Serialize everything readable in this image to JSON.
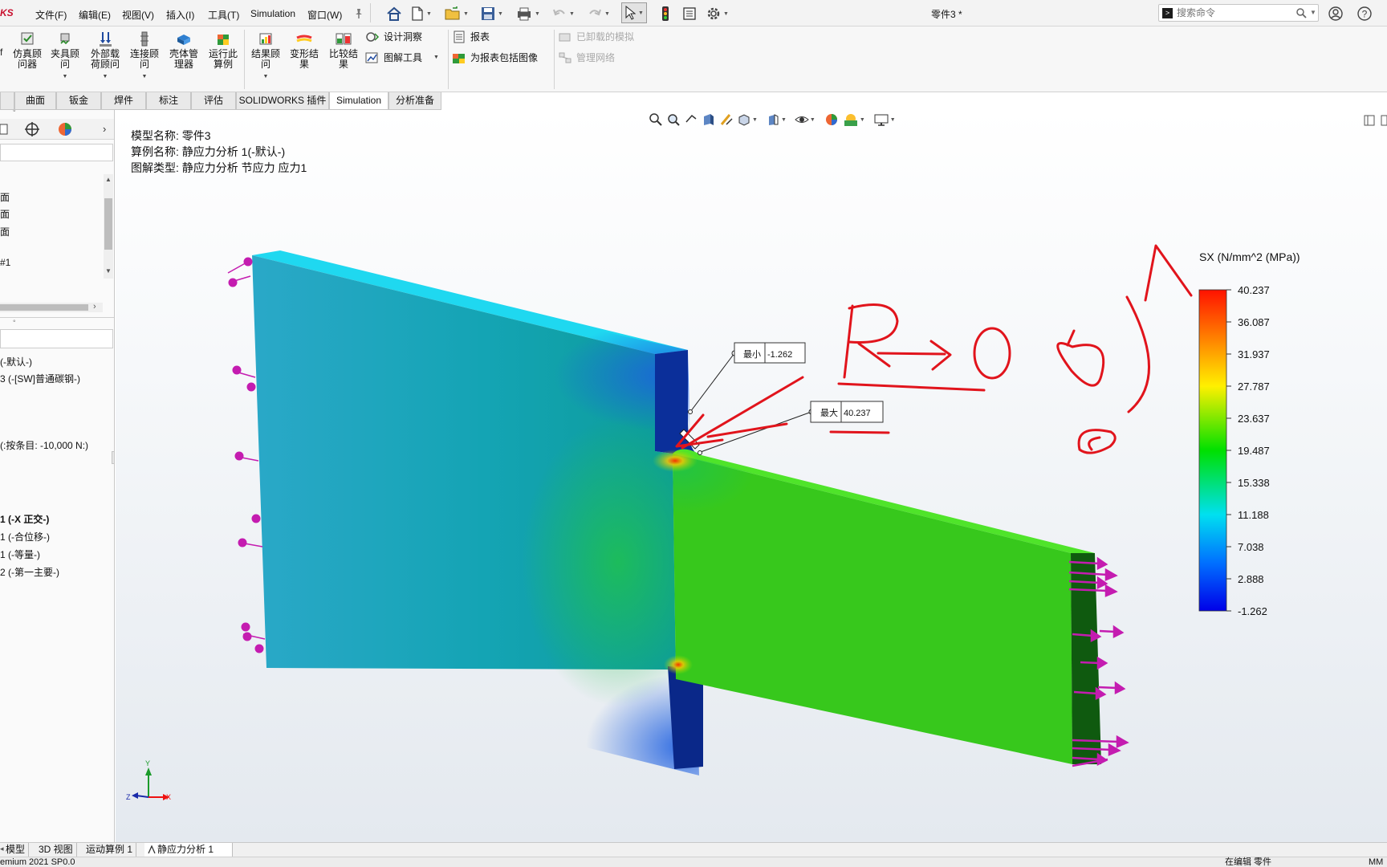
{
  "app": {
    "logo_text": "KS",
    "document_title": "零件3 *"
  },
  "menu": [
    {
      "label": "文件(F)"
    },
    {
      "label": "编辑(E)"
    },
    {
      "label": "视图(V)"
    },
    {
      "label": "插入(I)"
    },
    {
      "label": "工具(T)"
    },
    {
      "label": "Simulation"
    },
    {
      "label": "窗口(W)"
    }
  ],
  "search": {
    "placeholder": "搜索命令"
  },
  "ribbon": {
    "left_partial_label": "f",
    "buttons": [
      {
        "name": "simulation-advisor",
        "line1": "仿真顾",
        "line2": "问器",
        "icon": "advisor-icon"
      },
      {
        "name": "fixtures-advisor",
        "line1": "夹具顾",
        "line2": "问",
        "icon": "fixture-icon"
      },
      {
        "name": "external-loads-advisor",
        "line1": "外部载",
        "line2": "荷顾问",
        "icon": "load-icon"
      },
      {
        "name": "connections-advisor",
        "line1": "连接顾",
        "line2": "问",
        "icon": "connection-icon"
      },
      {
        "name": "shell-manager",
        "line1": "壳体管",
        "line2": "理器",
        "icon": "shell-icon"
      },
      {
        "name": "run-study",
        "line1": "运行此",
        "line2": "算例",
        "icon": "run-icon"
      },
      {
        "name": "results-advisor",
        "line1": "结果顾",
        "line2": "问",
        "icon": "results-icon"
      },
      {
        "name": "deformed-result",
        "line1": "变形结",
        "line2": "果",
        "icon": "deformed-icon"
      },
      {
        "name": "compare-results",
        "line1": "比较结",
        "line2": "果",
        "icon": "compare-icon"
      }
    ],
    "design_insight": "设计洞察",
    "plot_tools": "图解工具",
    "report": "报表",
    "include_image": "为报表包括图像",
    "unloaded_sims": "已卸载的模拟",
    "manage_network": "管理网络"
  },
  "command_tabs": [
    {
      "label": "曲面",
      "active": false
    },
    {
      "label": "钣金",
      "active": false
    },
    {
      "label": "焊件",
      "active": false
    },
    {
      "label": "标注",
      "active": false
    },
    {
      "label": "评估",
      "active": false
    },
    {
      "label": "SOLIDWORKS 插件",
      "active": false
    },
    {
      "label": "Simulation",
      "active": true
    },
    {
      "label": "分析准备",
      "active": false
    }
  ],
  "tree": {
    "items_top": [
      "面",
      "面",
      "面",
      "#1"
    ],
    "study_items": [
      {
        "label": "(-默认-)",
        "bold": false
      },
      {
        "label": "3 (-[SW]普通碳钢-)",
        "bold": false
      },
      {
        "label": "(:按条目: -10,000 N:)",
        "bold": false
      },
      {
        "label": "1 (-X 正交-)",
        "bold": true
      },
      {
        "label": "1 (-合位移-)",
        "bold": false
      },
      {
        "label": "1 (-等量-)",
        "bold": false
      },
      {
        "label": "2 (-第一主要-)",
        "bold": false
      }
    ]
  },
  "viewport": {
    "model_name": "模型名称: 零件3",
    "study_name": "算例名称: 静应力分析 1(-默认-)",
    "plot_type": "图解类型: 静应力分析 节应力 应力1",
    "min_label": "最小",
    "min_value": "-1.262",
    "max_label": "最大",
    "max_value": "40.237",
    "triad_y": "Y",
    "triad_x": "X",
    "triad_z": "Z"
  },
  "legend": {
    "title": "SX (N/mm^2 (MPa))",
    "values": [
      "40.237",
      "36.087",
      "31.937",
      "27.787",
      "23.637",
      "19.487",
      "15.338",
      "11.188",
      "7.038",
      "2.888",
      "-1.262"
    ]
  },
  "bottom_tabs": [
    {
      "label": "模型",
      "active": false
    },
    {
      "label": "3D 视图",
      "active": false
    },
    {
      "label": "运动算例 1",
      "active": false
    },
    {
      "label": "静应力分析 1",
      "active": true
    }
  ],
  "status": {
    "left": "emium 2021 SP0.0",
    "editing": "在编辑 零件",
    "units": "MM"
  },
  "colors": {
    "accent_red": "#e1141c",
    "arrow_magenta": "#c41cb0"
  }
}
